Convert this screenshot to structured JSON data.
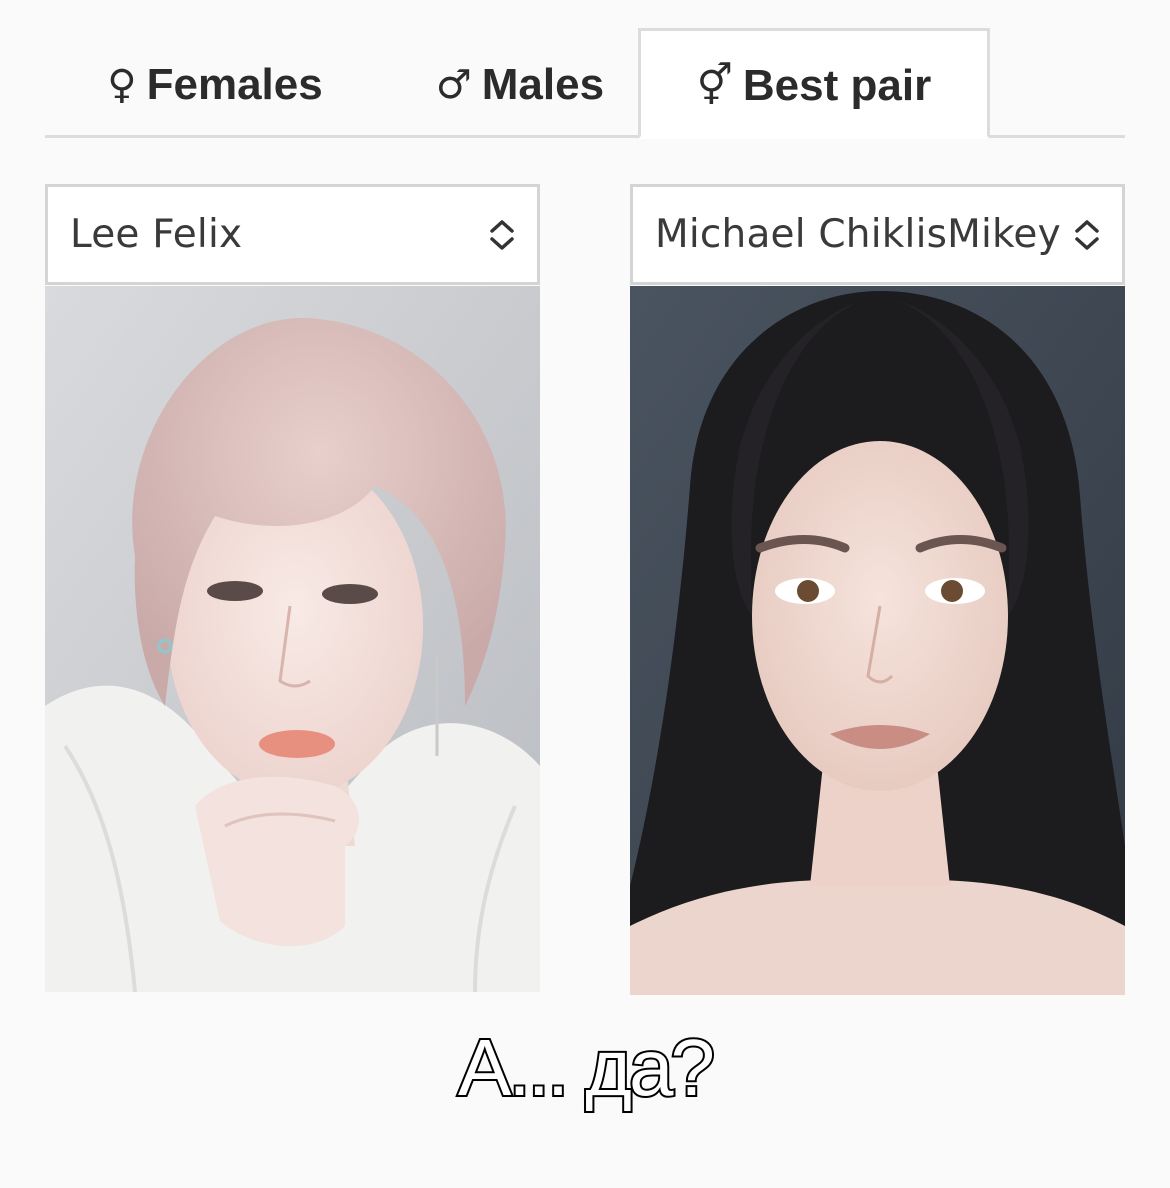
{
  "tabs": [
    {
      "symbol": "♀",
      "label": "Females",
      "active": false
    },
    {
      "symbol": "♂",
      "label": "Males",
      "active": false
    },
    {
      "symbol": "⚥",
      "label": "Best pair",
      "active": true
    }
  ],
  "selects": {
    "left": {
      "value": "Lee Felix"
    },
    "right": {
      "value": "Michael ChiklisMikey"
    }
  },
  "photos": {
    "left": {
      "description": "portrait-male-pink-hair"
    },
    "right": {
      "description": "portrait-female-dark-hair"
    }
  },
  "caption": "А... да?",
  "colors": {
    "background": "#fafafa",
    "tab_border": "#dcdcdc",
    "text": "#2b2b2b"
  }
}
